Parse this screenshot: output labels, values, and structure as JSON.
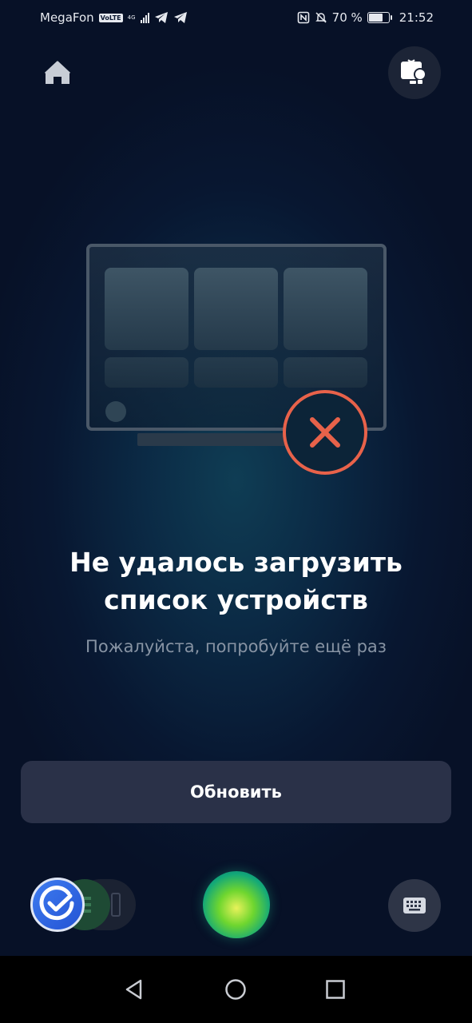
{
  "status_bar": {
    "carrier": "MegaFon",
    "volte": "VoLTE",
    "network": "4G",
    "battery_percent": "70 %",
    "battery_level": 0.7,
    "time": "21:52"
  },
  "header": {
    "home_icon": "home-icon",
    "devices_icon": "devices-icon"
  },
  "error": {
    "title": "Не удалось загрузить список устройств",
    "subtitle": "Пожалуйста, попробуйте ещё раз",
    "accent_color": "#e8624a"
  },
  "refresh_button": {
    "label": "Обновить"
  },
  "bottom_bar": {
    "assistant_icon": "assistant-orb-icon",
    "keyboard_icon": "keyboard-icon"
  },
  "nav": {
    "back_icon": "back-icon",
    "home_icon": "home-circle-icon",
    "recents_icon": "recents-icon"
  }
}
